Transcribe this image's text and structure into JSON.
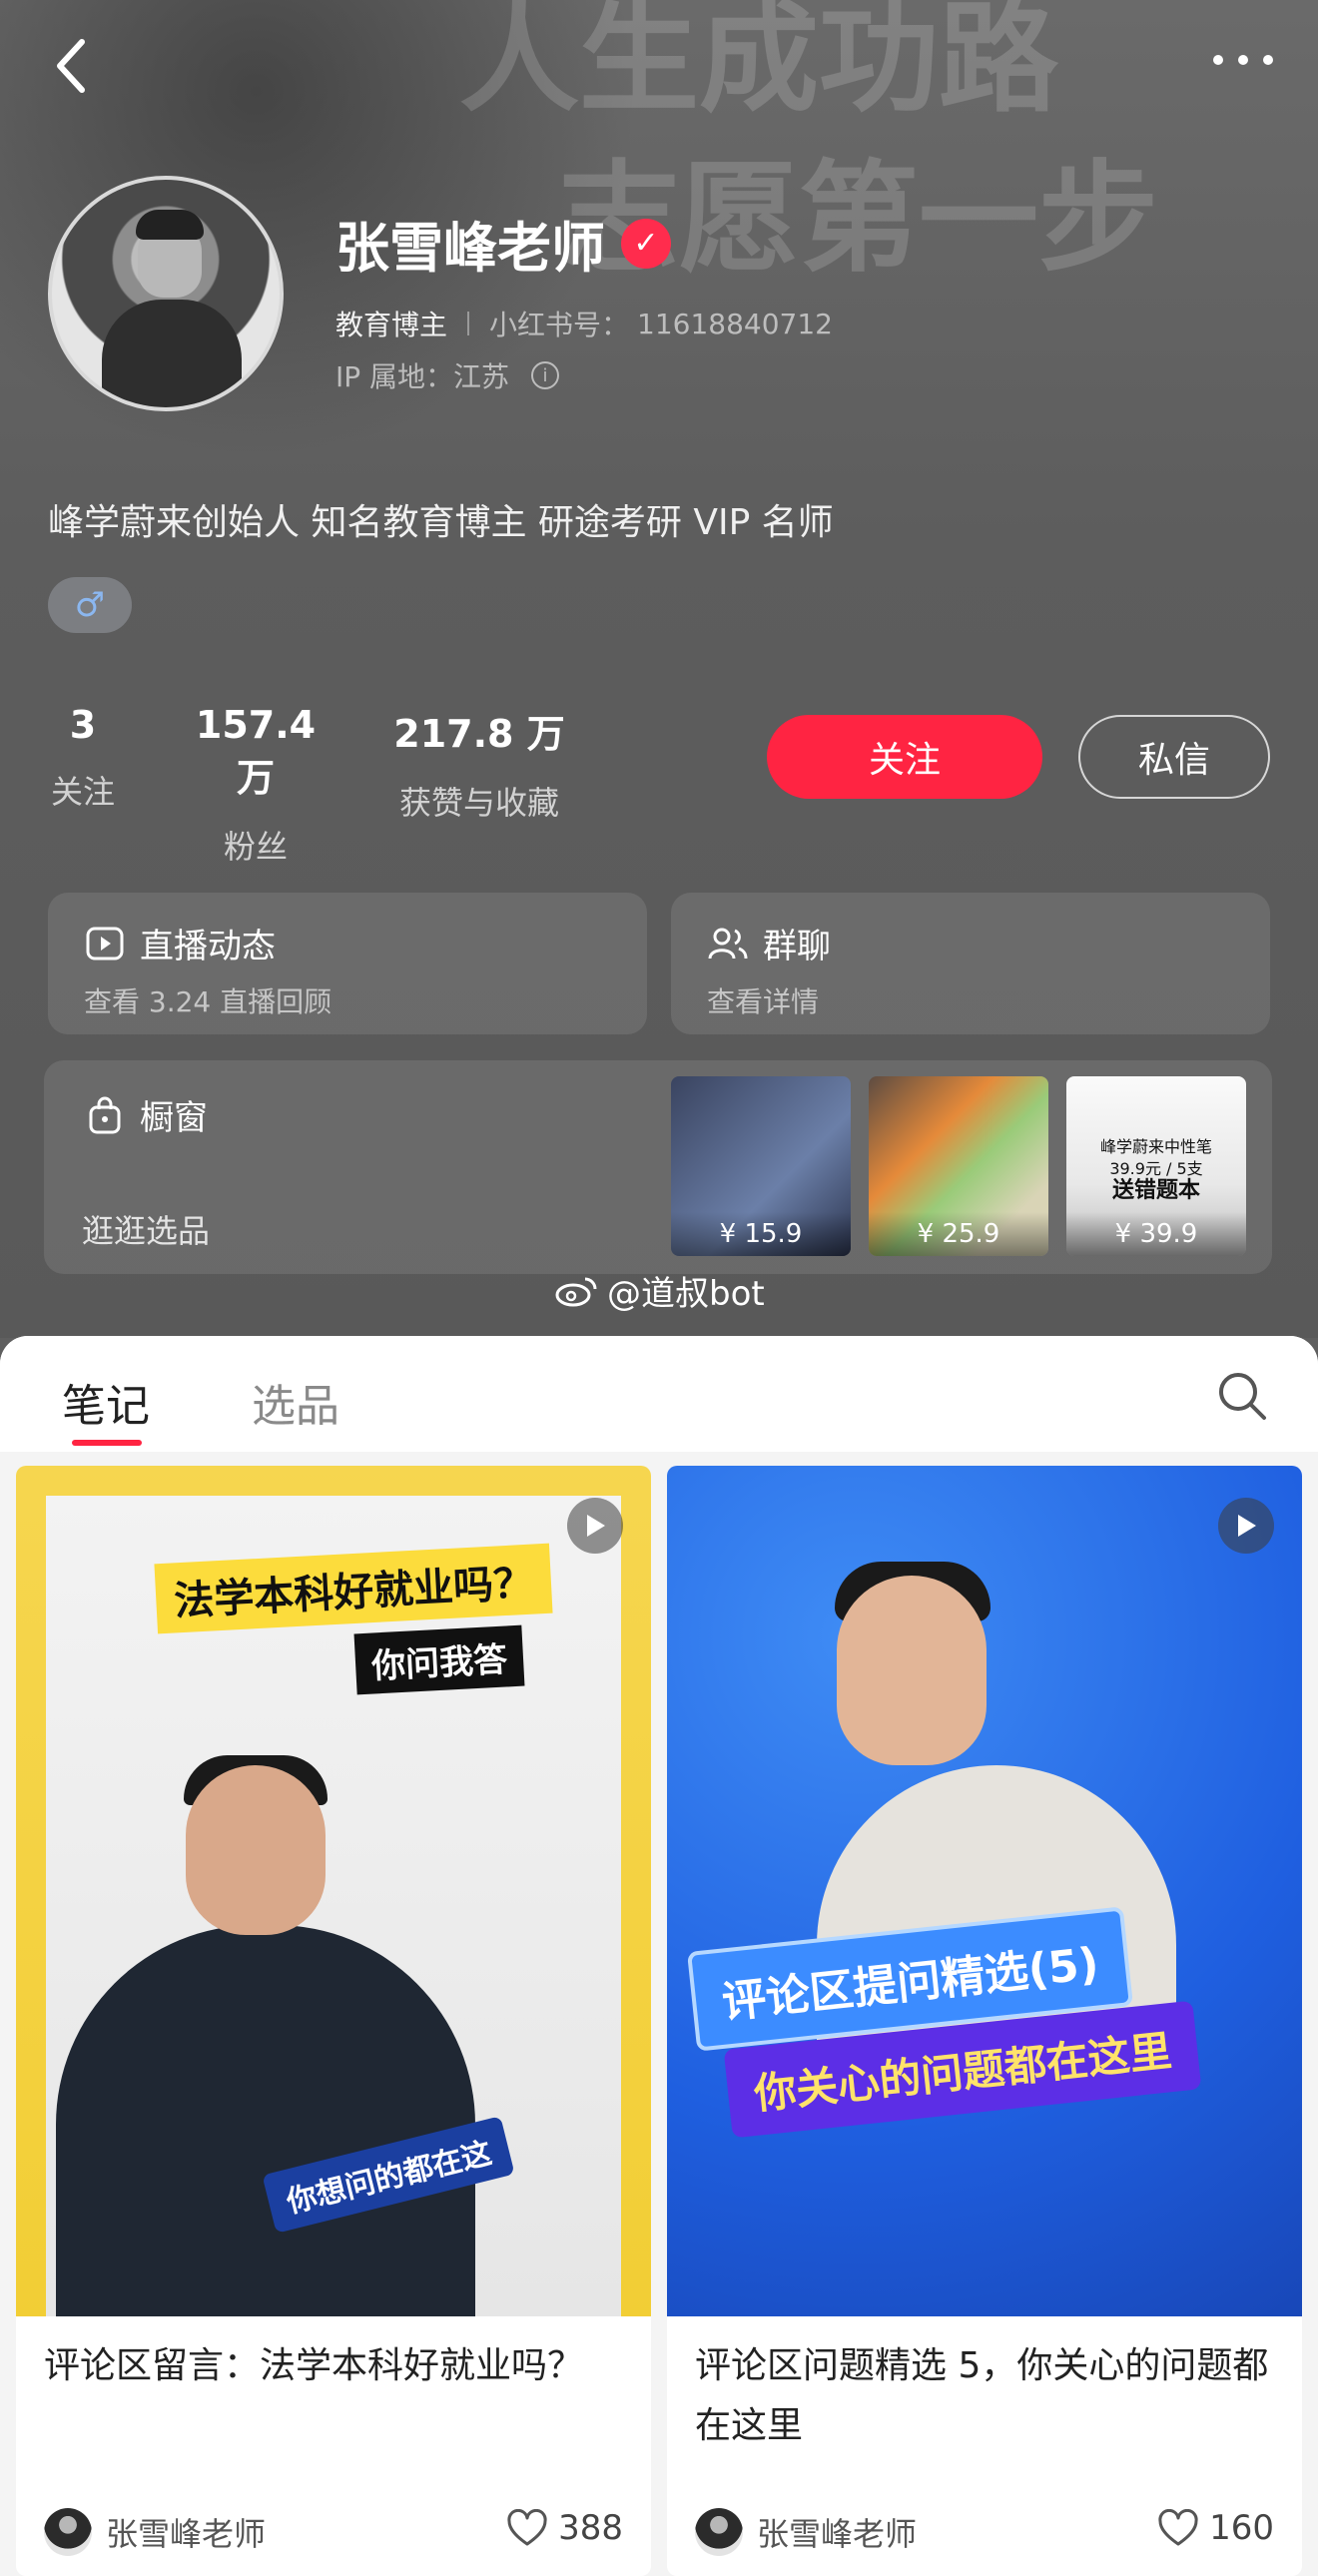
{
  "header": {
    "banner_text_line1": "人生成功路",
    "banner_text_line2": "志愿第一步"
  },
  "profile": {
    "name": "张雪峰老师",
    "verified_mark": "✓",
    "tag": "教育博主",
    "id_label": "小红书号：",
    "id_value": "11618840712",
    "ip_location": "IP 属地：江苏",
    "bio": "峰学蔚来创始人 知名教育博主 研途考研 VIP 名师",
    "gender_symbol": "♂"
  },
  "stats": {
    "following_value": "3",
    "following_label": "关注",
    "fans_value": "157.4 万",
    "fans_label": "粉丝",
    "likes_value": "217.8 万",
    "likes_label": "获赞与收藏"
  },
  "actions": {
    "follow_label": "关注",
    "message_label": "私信"
  },
  "cards": {
    "live_title": "直播动态",
    "live_sub": "查看 3.24 直播回顾",
    "group_title": "群聊",
    "group_sub": "查看详情",
    "shop_title": "橱窗",
    "shop_sub": "逛逛选品",
    "products": [
      {
        "price": "¥ 15.9"
      },
      {
        "price": "¥ 25.9"
      },
      {
        "price": "¥ 39.9",
        "line1": "峰学蔚来中性笔",
        "line2": "39.9元 / 5支",
        "line3": "送错题本"
      }
    ]
  },
  "watermark": "@道叔bot",
  "tabs": {
    "notes": "笔记",
    "selection": "选品"
  },
  "notes": [
    {
      "cover_line1": "法学本科好就业吗？",
      "cover_line2": "你问我答",
      "cover_line3": "你想问的都在这",
      "title": "评论区留言：法学本科好就业吗？",
      "author": "张雪峰老师",
      "likes": "388"
    },
    {
      "cover_line1": "评论区提问精选(5)",
      "cover_line2": "你关心的问题都在这里",
      "title": "评论区问题精选 5，你关心的问题都在这里",
      "author": "张雪峰老师",
      "likes": "160"
    }
  ],
  "colors": {
    "accent": "#ff2442",
    "verified": "#ff2c4d"
  },
  "icons": [
    "back-icon",
    "more-icon",
    "verified-icon",
    "info-icon",
    "male-icon",
    "live-icon",
    "group-icon",
    "bag-icon",
    "weibo-icon",
    "search-icon",
    "play-icon",
    "heart-icon"
  ]
}
